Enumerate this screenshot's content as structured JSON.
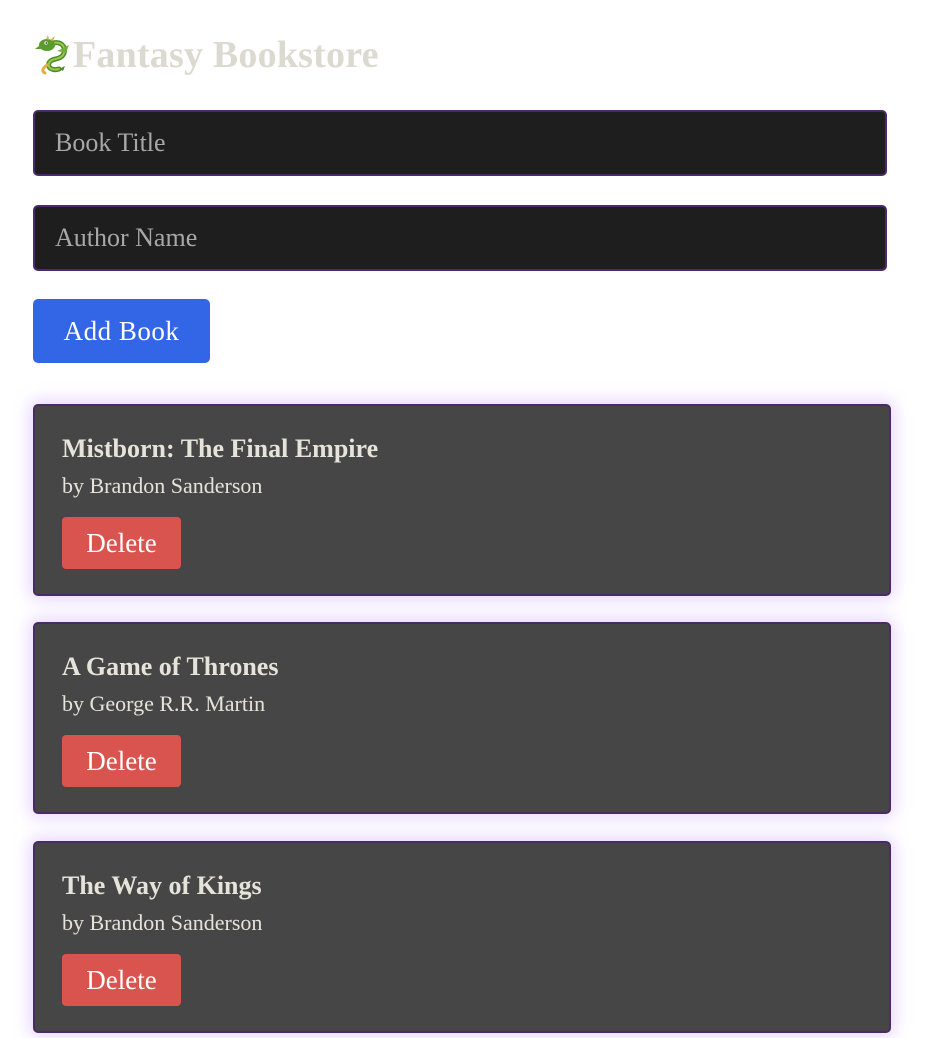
{
  "header": {
    "icon": "dragon-icon",
    "title": "Fantasy Bookstore",
    "title_color": "#dcdad0"
  },
  "form": {
    "title_placeholder": "Book Title",
    "title_value": "",
    "author_placeholder": "Author Name",
    "author_value": "",
    "add_label": "Add Book",
    "add_color": "#3366e6"
  },
  "books": [
    {
      "title": "Mistborn: The Final Empire",
      "author": "by Brandon Sanderson",
      "delete_label": "Delete"
    },
    {
      "title": "A Game of Thrones",
      "author": "by George R.R. Martin",
      "delete_label": "Delete"
    },
    {
      "title": "The Way of Kings",
      "author": "by Brandon Sanderson",
      "delete_label": "Delete"
    }
  ],
  "colors": {
    "card_background": "#464646",
    "card_border": "#4a2a6a",
    "card_glow": "#be8cff",
    "delete": "#d9534f",
    "input_background": "#1e1e1e"
  }
}
